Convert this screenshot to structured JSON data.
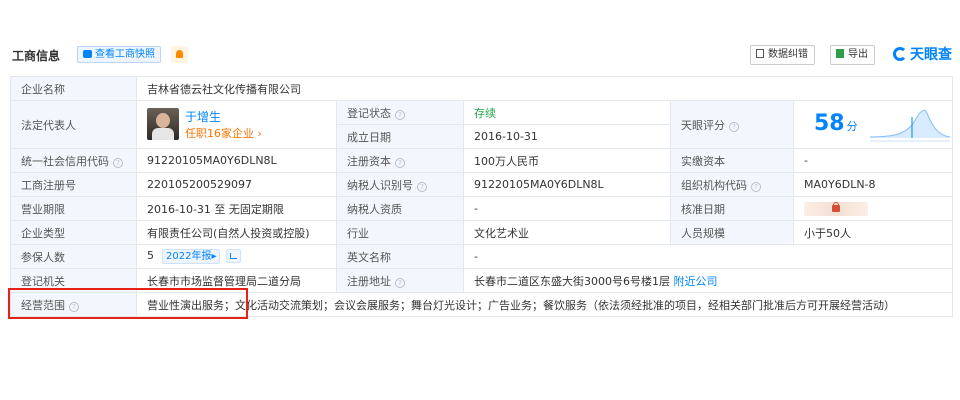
{
  "header": {
    "title": "工商信息",
    "snapshot_label": "查看工商快照",
    "correction_label": "数据纠错",
    "export_label": "导出",
    "brand": "天眼查"
  },
  "rows": {
    "company_name_key": "企业名称",
    "company_name": "吉林省德云社文化传播有限公司",
    "legal_rep_key": "法定代表人",
    "legal_rep_name": "于增生",
    "legal_rep_sub": "任职16家企业",
    "reg_status_key": "登记状态",
    "reg_status": "存续",
    "established_key": "成立日期",
    "established": "2016-10-31",
    "score_key": "天眼评分",
    "score_value": "58",
    "score_unit": "分",
    "credit_code_key": "统一社会信用代码",
    "credit_code": "91220105MA0Y6DLN8L",
    "capital_key": "注册资本",
    "capital": "100万人民币",
    "paid_capital_key": "实缴资本",
    "paid_capital": "-",
    "reg_no_key": "工商注册号",
    "reg_no": "220105200529097",
    "taxpayer_id_key": "纳税人识别号",
    "taxpayer_id": "91220105MA0Y6DLN8L",
    "org_code_key": "组织机构代码",
    "org_code": "MA0Y6DLN-8",
    "term_key": "营业期限",
    "term": "2016-10-31 至 无固定期限",
    "taxpayer_qual_key": "纳税人资质",
    "taxpayer_qual": "-",
    "approval_date_key": "核准日期",
    "type_key": "企业类型",
    "type": "有限责任公司(自然人投资或控股)",
    "industry_key": "行业",
    "industry": "文化艺术业",
    "staff_size_key": "人员规模",
    "staff_size": "小于50人",
    "insured_key": "参保人数",
    "insured": "5",
    "insured_annual": "2022年报",
    "english_name_key": "英文名称",
    "english_name": "-",
    "authority_key": "登记机关",
    "authority": "长春市市场监督管理局二道分局",
    "address_key": "注册地址",
    "address": "长春市二道区东盛大街3000号6号楼1层",
    "nearby_label": "附近公司",
    "scope_key": "经营范围",
    "scope": "营业性演出服务；文化活动交流策划；会议会展服务；舞台灯光设计；广告业务；餐饮服务（依法须经批准的项目，经相关部门批准后方可开展经营活动）"
  },
  "colors": {
    "accent": "#0084ff",
    "status_green": "#20a84b",
    "highlight_red": "#e62117",
    "key_bg": "#f3f7fd"
  }
}
